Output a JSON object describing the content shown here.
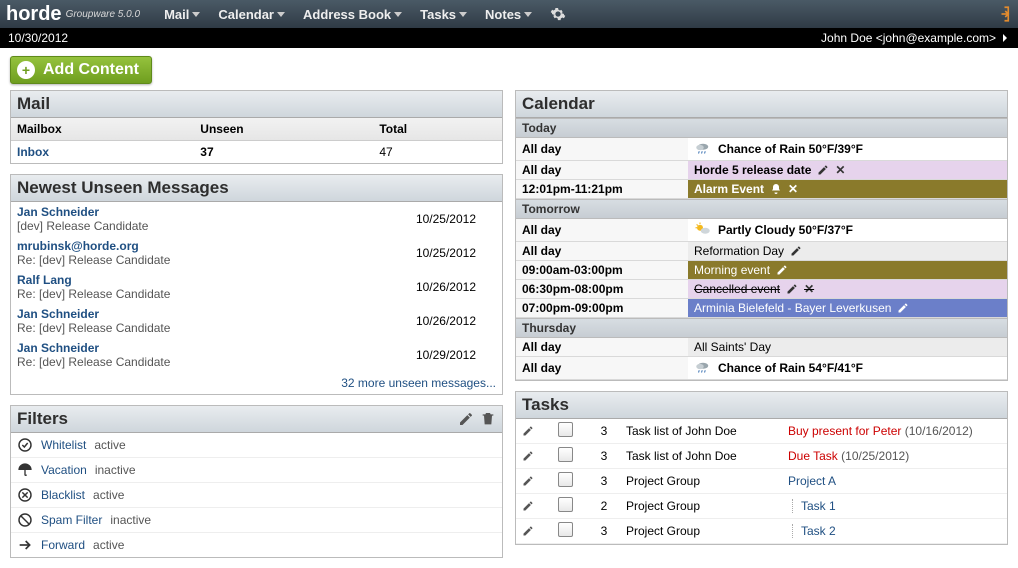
{
  "app": {
    "name": "horde",
    "subtitle": "Groupware 5.0.0"
  },
  "menu": {
    "items": [
      {
        "label": "Mail"
      },
      {
        "label": "Calendar"
      },
      {
        "label": "Address Book"
      },
      {
        "label": "Tasks"
      },
      {
        "label": "Notes"
      }
    ]
  },
  "infobar": {
    "date": "10/30/2012",
    "user": "John Doe <john@example.com>"
  },
  "add_content": {
    "label": "Add Content"
  },
  "mail": {
    "title": "Mail",
    "hdr_mailbox": "Mailbox",
    "hdr_unseen": "Unseen",
    "hdr_total": "Total",
    "inbox_label": "Inbox",
    "unseen": "37",
    "total": "47"
  },
  "newest": {
    "title": "Newest Unseen Messages",
    "rows": [
      {
        "from": "Jan Schneider",
        "subject": "[dev] Release Candidate",
        "date": "10/25/2012"
      },
      {
        "from": "mrubinsk@horde.org",
        "subject": "Re: [dev] Release Candidate",
        "date": "10/25/2012"
      },
      {
        "from": "Ralf Lang",
        "subject": "Re: [dev] Release Candidate",
        "date": "10/26/2012"
      },
      {
        "from": "Jan Schneider",
        "subject": "Re: [dev] Release Candidate",
        "date": "10/26/2012"
      },
      {
        "from": "Jan Schneider",
        "subject": "Re: [dev] Release Candidate",
        "date": "10/29/2012"
      }
    ],
    "more": "32 more unseen messages..."
  },
  "filters": {
    "title": "Filters",
    "rows": [
      {
        "icon": "check-circle",
        "name": "Whitelist",
        "state": "active"
      },
      {
        "icon": "umbrella",
        "name": "Vacation",
        "state": "inactive"
      },
      {
        "icon": "x-circle",
        "name": "Blacklist",
        "state": "active"
      },
      {
        "icon": "no-entry",
        "name": "Spam Filter",
        "state": "inactive"
      },
      {
        "icon": "arrow-right",
        "name": "Forward",
        "state": "active"
      }
    ]
  },
  "calendar": {
    "title": "Calendar",
    "sections": [
      {
        "label": "Today",
        "rows": [
          {
            "time": "All day",
            "kind": "weather",
            "weather_icon": "rain",
            "text": "Chance of Rain 50°F/39°F"
          },
          {
            "time": "All day",
            "kind": "release",
            "text": "Horde 5 release date",
            "editable": true,
            "deletable": true
          },
          {
            "time": "12:01pm-11:21pm",
            "kind": "alarm",
            "text": "Alarm Event",
            "alarm": true,
            "deletable": true
          }
        ]
      },
      {
        "label": "Tomorrow",
        "rows": [
          {
            "time": "All day",
            "kind": "weather",
            "weather_icon": "partly",
            "text": "Partly Cloudy 50°F/37°F"
          },
          {
            "time": "All day",
            "kind": "reform",
            "text": "Reformation Day",
            "editable": true
          },
          {
            "time": "09:00am-03:00pm",
            "kind": "morning",
            "text": "Morning event",
            "editable": true
          },
          {
            "time": "06:30pm-08:00pm",
            "kind": "cancel",
            "text": "Cancelled event",
            "editable": true,
            "deletable": true
          },
          {
            "time": "07:00pm-09:00pm",
            "kind": "match",
            "text": "Arminia Bielefeld - Bayer Leverkusen",
            "editable": true
          }
        ]
      },
      {
        "label": "Thursday",
        "rows": [
          {
            "time": "All day",
            "kind": "allsaints",
            "text": "All Saints' Day"
          },
          {
            "time": "All day",
            "kind": "weather",
            "weather_icon": "rain",
            "text": "Chance of Rain 54°F/41°F"
          }
        ]
      }
    ]
  },
  "tasks": {
    "title": "Tasks",
    "rows": [
      {
        "priority": "3",
        "list": "Task list of John Doe",
        "name": "Buy present for Peter",
        "overdue": true,
        "due": "(10/16/2012)",
        "sub": false
      },
      {
        "priority": "3",
        "list": "Task list of John Doe",
        "name": "Due Task",
        "overdue": true,
        "due": "(10/25/2012)",
        "sub": false
      },
      {
        "priority": "3",
        "list": "Project Group",
        "name": "Project A",
        "overdue": false,
        "due": "",
        "sub": false
      },
      {
        "priority": "2",
        "list": "Project Group",
        "name": "Task 1",
        "overdue": false,
        "due": "",
        "sub": true
      },
      {
        "priority": "3",
        "list": "Project Group",
        "name": "Task 2",
        "overdue": false,
        "due": "",
        "sub": true
      }
    ]
  }
}
